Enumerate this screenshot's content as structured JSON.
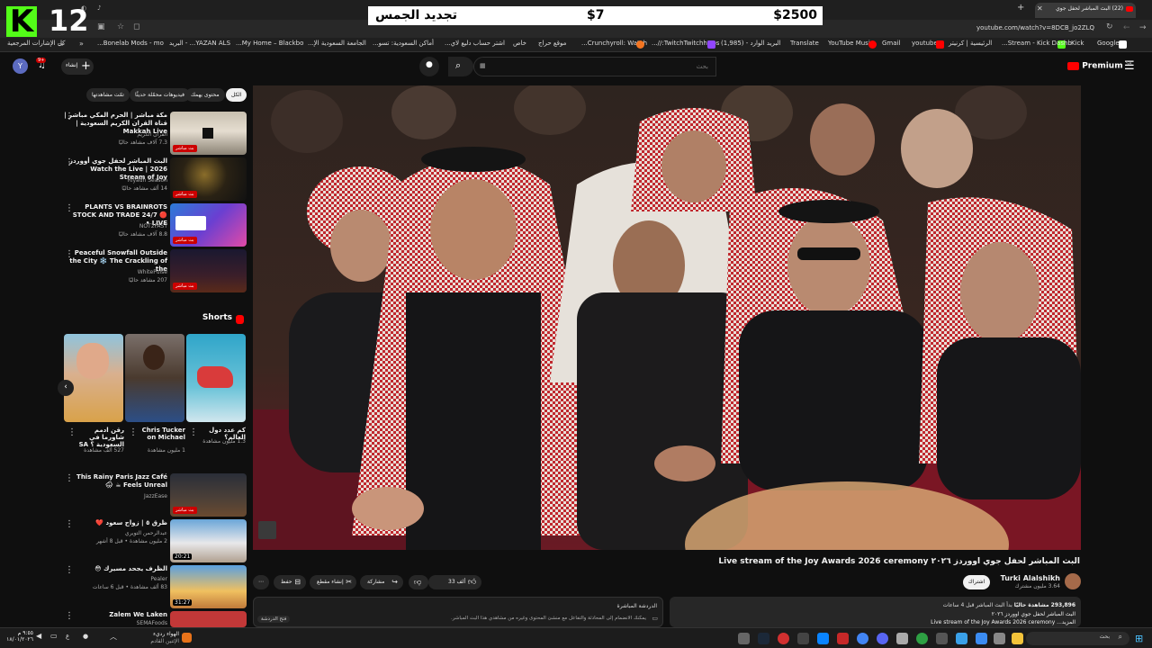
{
  "overlay": {
    "logo_letter": "K",
    "number": "12",
    "donation_left": "$2500",
    "donation_mid": "$7",
    "donation_right": "تجديد الجمس"
  },
  "browser": {
    "tab_title": "(22) البث المباشر لحفل جوي",
    "url": "youtube.com/watch?v=8DCB_jo2ZLQ",
    "bookmarks": [
      "Google",
      "Kick",
      "Stream - Kick Dashb...",
      "الرئيسية | كرنيتر",
      "youtube",
      "Gmail",
      "YouTube Music",
      "Translate",
      "البريد الوارد - (1,985)",
      "TwitchTwitchhttps://...",
      "Crunchyroll: Watch...",
      "موقع حراج",
      "خاص",
      "اشتر حساب دليع لاي...",
      "أماكن السعودية: تسو...",
      "الجامعة السعودية الإ...",
      "My Home – Blackbo...",
      "YAZAN ALS... - البريد",
      "Bonelab Mods - mo..."
    ],
    "all_bookmarks": "كل الإشارات المرجعية"
  },
  "header": {
    "premium": "Premium",
    "premium_sup": "SA",
    "search_placeholder": "بحث",
    "create_label": "إنشاء",
    "notif_count": "9+",
    "avatar_letter": "Y"
  },
  "chips": [
    "الكل",
    "محتوى يهمك",
    "فيديوهات محمّلة حديثًا",
    "تمّت مشاهدتها"
  ],
  "sidebar": {
    "videos_top": [
      {
        "title": "مكة مباشر | الحرم المكي مباشر | قناة القران الكريم السعودية | Makkah Live",
        "channel": "القرآن الكريم",
        "meta": "7.3 آلاف مشاهد حاليًا",
        "badge": "بث مباشر"
      },
      {
        "title": "البث المباشر لحفل جوي أووردز 2026 | Watch the Live Stream of Joy",
        "channel": "Riyadh Season",
        "meta": "14 ألف مشاهد حاليًا",
        "badge": "بث مباشر"
      },
      {
        "title": "PLANTS VS BRAINROTS STOCK AND TRADE 24/7 🔴 LIVE •",
        "channel": "NOT2FAST",
        "meta": "8.8 آلاف مشاهد حاليًا",
        "badge": "بث مباشر"
      },
      {
        "title": "Peaceful Snowfall Outside the City ❄️ The Crackling of the",
        "channel": "WhitePulse",
        "meta": "207 مشاهد حاليًا",
        "badge": "بث مباشر"
      }
    ],
    "shorts_title": "Shorts",
    "shorts": [
      {
        "title": "كم عدد دول العالم؟",
        "meta": "1.3 مليون مشاهدة"
      },
      {
        "title": "Chris Tucker on Michael",
        "meta": "1 مليون مشاهدة"
      },
      {
        "title": "رقن ادمم شاورما في السعودية ؟ SA",
        "meta": "527 ألف مشاهدة"
      }
    ],
    "videos_bottom": [
      {
        "title": "This Rainy Paris Jazz Café Feels Unreal ☕ 🌧",
        "channel": "JazzEase",
        "meta": "",
        "badge": "بث مباشر"
      },
      {
        "title": "ظرق ٥ | زواج سعود ❤️",
        "channel": "عبدالرحمن التويري",
        "meta": "2 مليون مشاهدة • قبل 8 أشهر",
        "duration": "20:21"
      },
      {
        "title": "الظرف يجحد مسيرك 😳",
        "channel": "Pealer",
        "meta": "83 ألف مشاهدة • قبل 6 ساعات",
        "duration": "31:27"
      },
      {
        "title": "Zalem We Laken",
        "channel": "SEMAFoods",
        "meta": ""
      }
    ]
  },
  "video": {
    "title": "البث المباشر لحفل جوي اووردز ٢٠٢٦ Live stream of the Joy Awards 2026 ceremony",
    "channel": "Turki Alalshikh",
    "subs": "3.64 مليون مشترك",
    "subscribe": "اشتراك",
    "likes": "33 ألف",
    "share": "مشاركة",
    "clip": "إنشاء مقطع",
    "save": "حفظ",
    "views": "293,896 مشاهدة حاليًا",
    "started": "بدأ البث المباشر قبل 4 ساعات",
    "desc_line": "البث المباشر لحفل جوي اووردز ٢٠٢٦",
    "desc_line2": "Live stream of the Joy Awards 2026 ceremony ...المزيد",
    "chat_title": "الدردشة المباشرة",
    "chat_text": "يمكنك الانضمام إلى المحادثة والتفاعل مع منشئ المحتوى وغيره من مشاهدي هذا البث المباشر.",
    "chat_btn": "فتح الدردشة"
  },
  "taskbar": {
    "clock_time": "٩:٥٥ م",
    "clock_date": "١٨/٠١/٢٠٢٦",
    "weather": "الهواء رديء",
    "weather_sub": "الإثنين القادم",
    "search": "بحث",
    "lang": "ع"
  }
}
